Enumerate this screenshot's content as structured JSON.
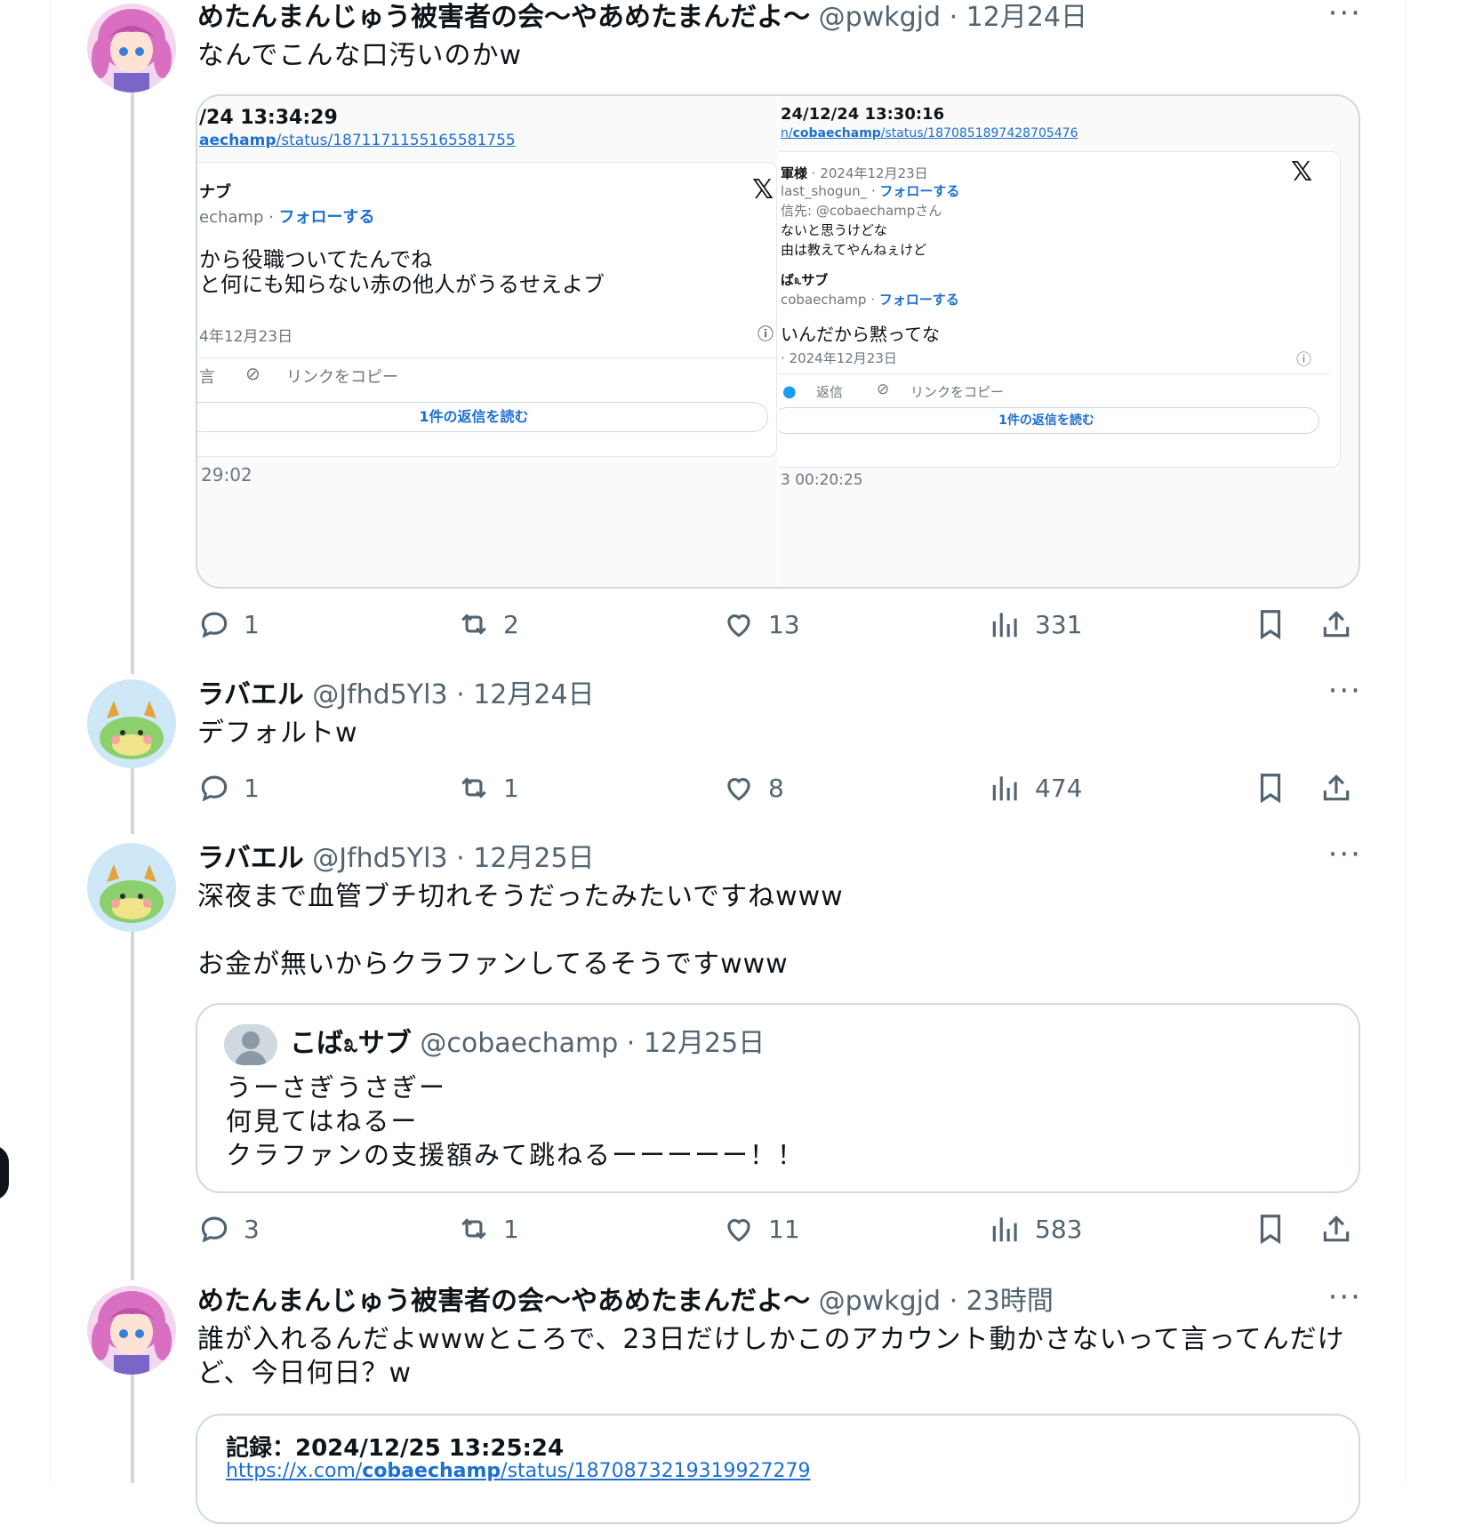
{
  "colors": {
    "accent": "#1d9bf0",
    "text": "#0f1419",
    "muted": "#536471",
    "border": "#cfd9de"
  },
  "tweets": [
    {
      "name": "めたんまんじゅう被害者の会〜やあめたまんだよ〜",
      "handle": "@pwkgjd",
      "date": "12月24日",
      "text": "なんでこんな口汚いのかw",
      "more": "···",
      "stats": {
        "replies": "1",
        "retweets": "2",
        "likes": "13",
        "views": "331"
      },
      "card": {
        "left": {
          "timestamp": "/24 13:34:29",
          "url_bold": "aechamp",
          "url_rest": "/status/1871171155165581755",
          "user": "ナブ",
          "handle_line": "echamp · ",
          "follow": "フォローする",
          "line1": "から役職ついてたんでね",
          "line2": "と何にも知らない赤の他人がうるせえよブ",
          "date": "4年12月23日",
          "reply_frag": "言",
          "copy_link": "リンクをコピー",
          "read_replies": "1件の返信を読む",
          "footer": "29:02"
        },
        "right": {
          "timestamp": "24/12/24 13:30:16",
          "url_pre": "n/",
          "url_bold": "cobaechamp",
          "url_rest": "/status/1870851897428705476",
          "user1": "軍様",
          "user1_date": " · 2024年12月23日",
          "handle1": "last_shogun_ · ",
          "follow": "フォローする",
          "reply_to": "信先: @cobaechampさん",
          "line1": "ないと思うけどな",
          "line2": "由は教えてやんねぇけど",
          "user2": "ば೩サブ",
          "handle2": "cobaechamp · ",
          "line3": "いんだから黙ってな",
          "date": "· 2024年12月23日",
          "reply": "返信",
          "copy_link": "リンクをコピー",
          "read_replies": "1件の返信を読む",
          "footer": "3 00:20:25"
        }
      }
    },
    {
      "name": "ラバエル",
      "handle": "@Jfhd5Yl3",
      "date": "12月24日",
      "text": "デフォルトw",
      "more": "···",
      "stats": {
        "replies": "1",
        "retweets": "1",
        "likes": "8",
        "views": "474"
      }
    },
    {
      "name": "ラバエル",
      "handle": "@Jfhd5Yl3",
      "date": "12月25日",
      "text": "深夜まで血管ブチ切れそうだったみたいですねwww\n\nお金が無いからクラファンしてるそうですwww",
      "more": "···",
      "quote": {
        "name": "こば೩サブ",
        "handle": "@cobaechamp",
        "date": "12月25日",
        "text": "うーさぎうさぎー\n何見てはねるー\nクラファンの支援額みて跳ねるーーーーー！！"
      },
      "stats": {
        "replies": "3",
        "retweets": "1",
        "likes": "11",
        "views": "583"
      }
    },
    {
      "name": "めたんまんじゅう被害者の会〜やあめたまんだよ〜",
      "handle": "@pwkgjd",
      "date": "23時間",
      "text": "誰が入れるんだよwwwところで、23日だけしかこのアカウント動かさないって言ってんだけど、今日何日？w",
      "more": "···",
      "card": {
        "record": "記録：2024/12/25 13:25:24",
        "url_pre": "https://x.com/",
        "url_bold": "cobaechamp",
        "url_rest": "/status/1870873219319927279"
      }
    }
  ]
}
